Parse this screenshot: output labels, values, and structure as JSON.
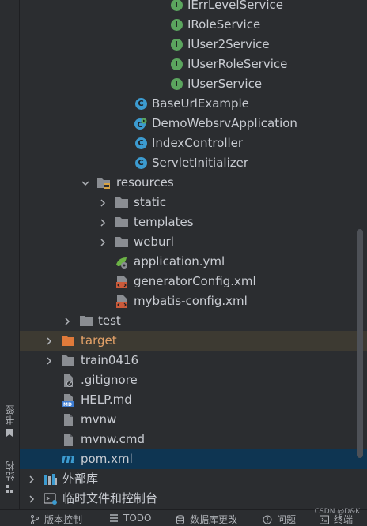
{
  "side_tabs": {
    "bookmarks": "书签",
    "structure": "结构"
  },
  "tree": {
    "ierr_level_service": "IErrLevelService",
    "irole_service": "IRoleService",
    "iuser2_service": "IUser2Service",
    "iuser_role_service": "IUserRoleService",
    "iuser_service": "IUserService",
    "base_url_example": "BaseUrlExample",
    "demo_app": "DemoWebsrvApplication",
    "index_controller": "IndexController",
    "servlet_initializer": "ServletInitializer",
    "resources": "resources",
    "static": "static",
    "templates": "templates",
    "weburl": "weburl",
    "application_yml": "application.yml",
    "generator_config": "generatorConfig.xml",
    "mybatis_config": "mybatis-config.xml",
    "test": "test",
    "target": "target",
    "train": "train0416",
    "gitignore": ".gitignore",
    "help_md": "HELP.md",
    "mvnw": "mvnw",
    "mvnw_cmd": "mvnw.cmd",
    "pom_xml": "pom.xml",
    "external_libs": "外部库",
    "scratches": "临时文件和控制台"
  },
  "status_bar": {
    "version_control": "版本控制",
    "todo": "TODO",
    "db_changes": "数据库更改",
    "problems": "问题",
    "terminal": "终端",
    "watermark": "CSDN @D&K."
  },
  "icons": {
    "interface": "I",
    "class": "C"
  },
  "colors": {
    "panel_bg": "#2b2d30",
    "selected_row": "#0e3552",
    "highlighted_row": "#3d3a32",
    "excluded_folder": "#e3a168",
    "interface_icon": "#5ba55e",
    "class_icon": "#3c9bd0"
  }
}
